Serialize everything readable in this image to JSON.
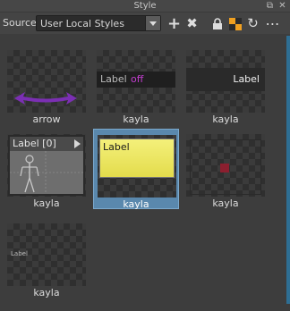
{
  "window": {
    "title": "Style",
    "float_label": "⧉",
    "close_label": "✕"
  },
  "toolbar": {
    "source_label": "Source",
    "source_value": "User Local Styles",
    "add_icon": "+",
    "delete_icon": "✖",
    "lock_icon": "lock-icon",
    "swatch_icon": "swatch-icon",
    "refresh_icon": "↻",
    "more_icon": "⋯"
  },
  "styles": [
    {
      "name": "arrow",
      "preview": "purple-double-arrow",
      "selected": false
    },
    {
      "name": "kayla",
      "preview": "label-off",
      "preview_text": "Label",
      "preview_value": "off",
      "value_color": "#c23ecf",
      "selected": false
    },
    {
      "name": "kayla",
      "preview": "dark-label",
      "preview_text": "Label",
      "selected": false
    },
    {
      "name": "kayla",
      "preview": "label-frame",
      "preview_text": "Label [0]",
      "selected": false
    },
    {
      "name": "kayla",
      "preview": "yellow-label",
      "preview_text": "Label",
      "selected": true
    },
    {
      "name": "kayla",
      "preview": "target-square",
      "square_color": "#8c1f2f",
      "selected": false
    },
    {
      "name": "kayla",
      "preview": "small-label",
      "preview_text": "Label",
      "selected": false
    }
  ],
  "colors": {
    "accent_selection": "#5a88ad",
    "arrow": "#7b2fb3",
    "panel_bg": "#444444"
  }
}
